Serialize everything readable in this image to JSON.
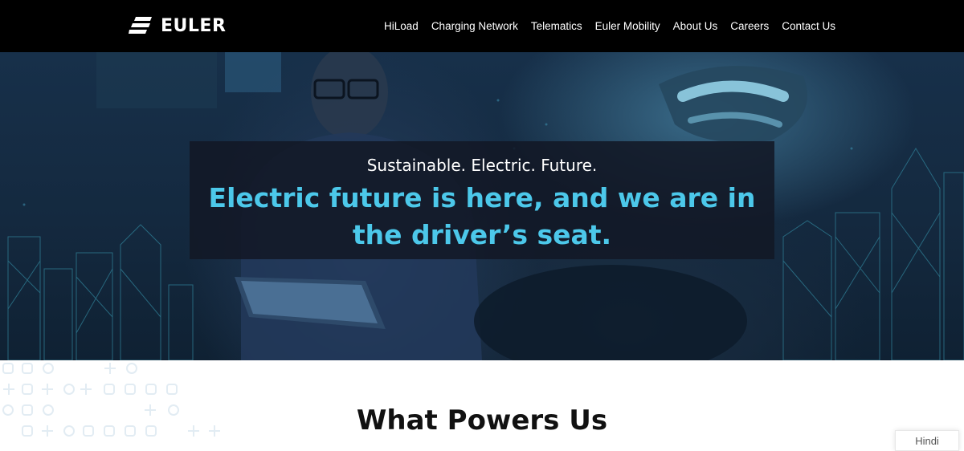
{
  "brand": {
    "name": "EULER",
    "logo_icon": "speed-lines-icon"
  },
  "nav": {
    "items": [
      {
        "label": "HiLoad"
      },
      {
        "label": "Charging Network"
      },
      {
        "label": "Telematics"
      },
      {
        "label": "Euler Mobility"
      },
      {
        "label": "About Us"
      },
      {
        "label": "Careers"
      },
      {
        "label": "Contact Us"
      }
    ]
  },
  "hero": {
    "tagline": "Sustainable. Electric. Future.",
    "headline": "Electric future is here, and we are in the driver’s seat."
  },
  "section": {
    "title": "What Powers Us"
  },
  "language": {
    "label": "Hindi"
  },
  "colors": {
    "header_bg": "#000000",
    "accent": "#4cc8ea",
    "hero_box": "#121826"
  }
}
